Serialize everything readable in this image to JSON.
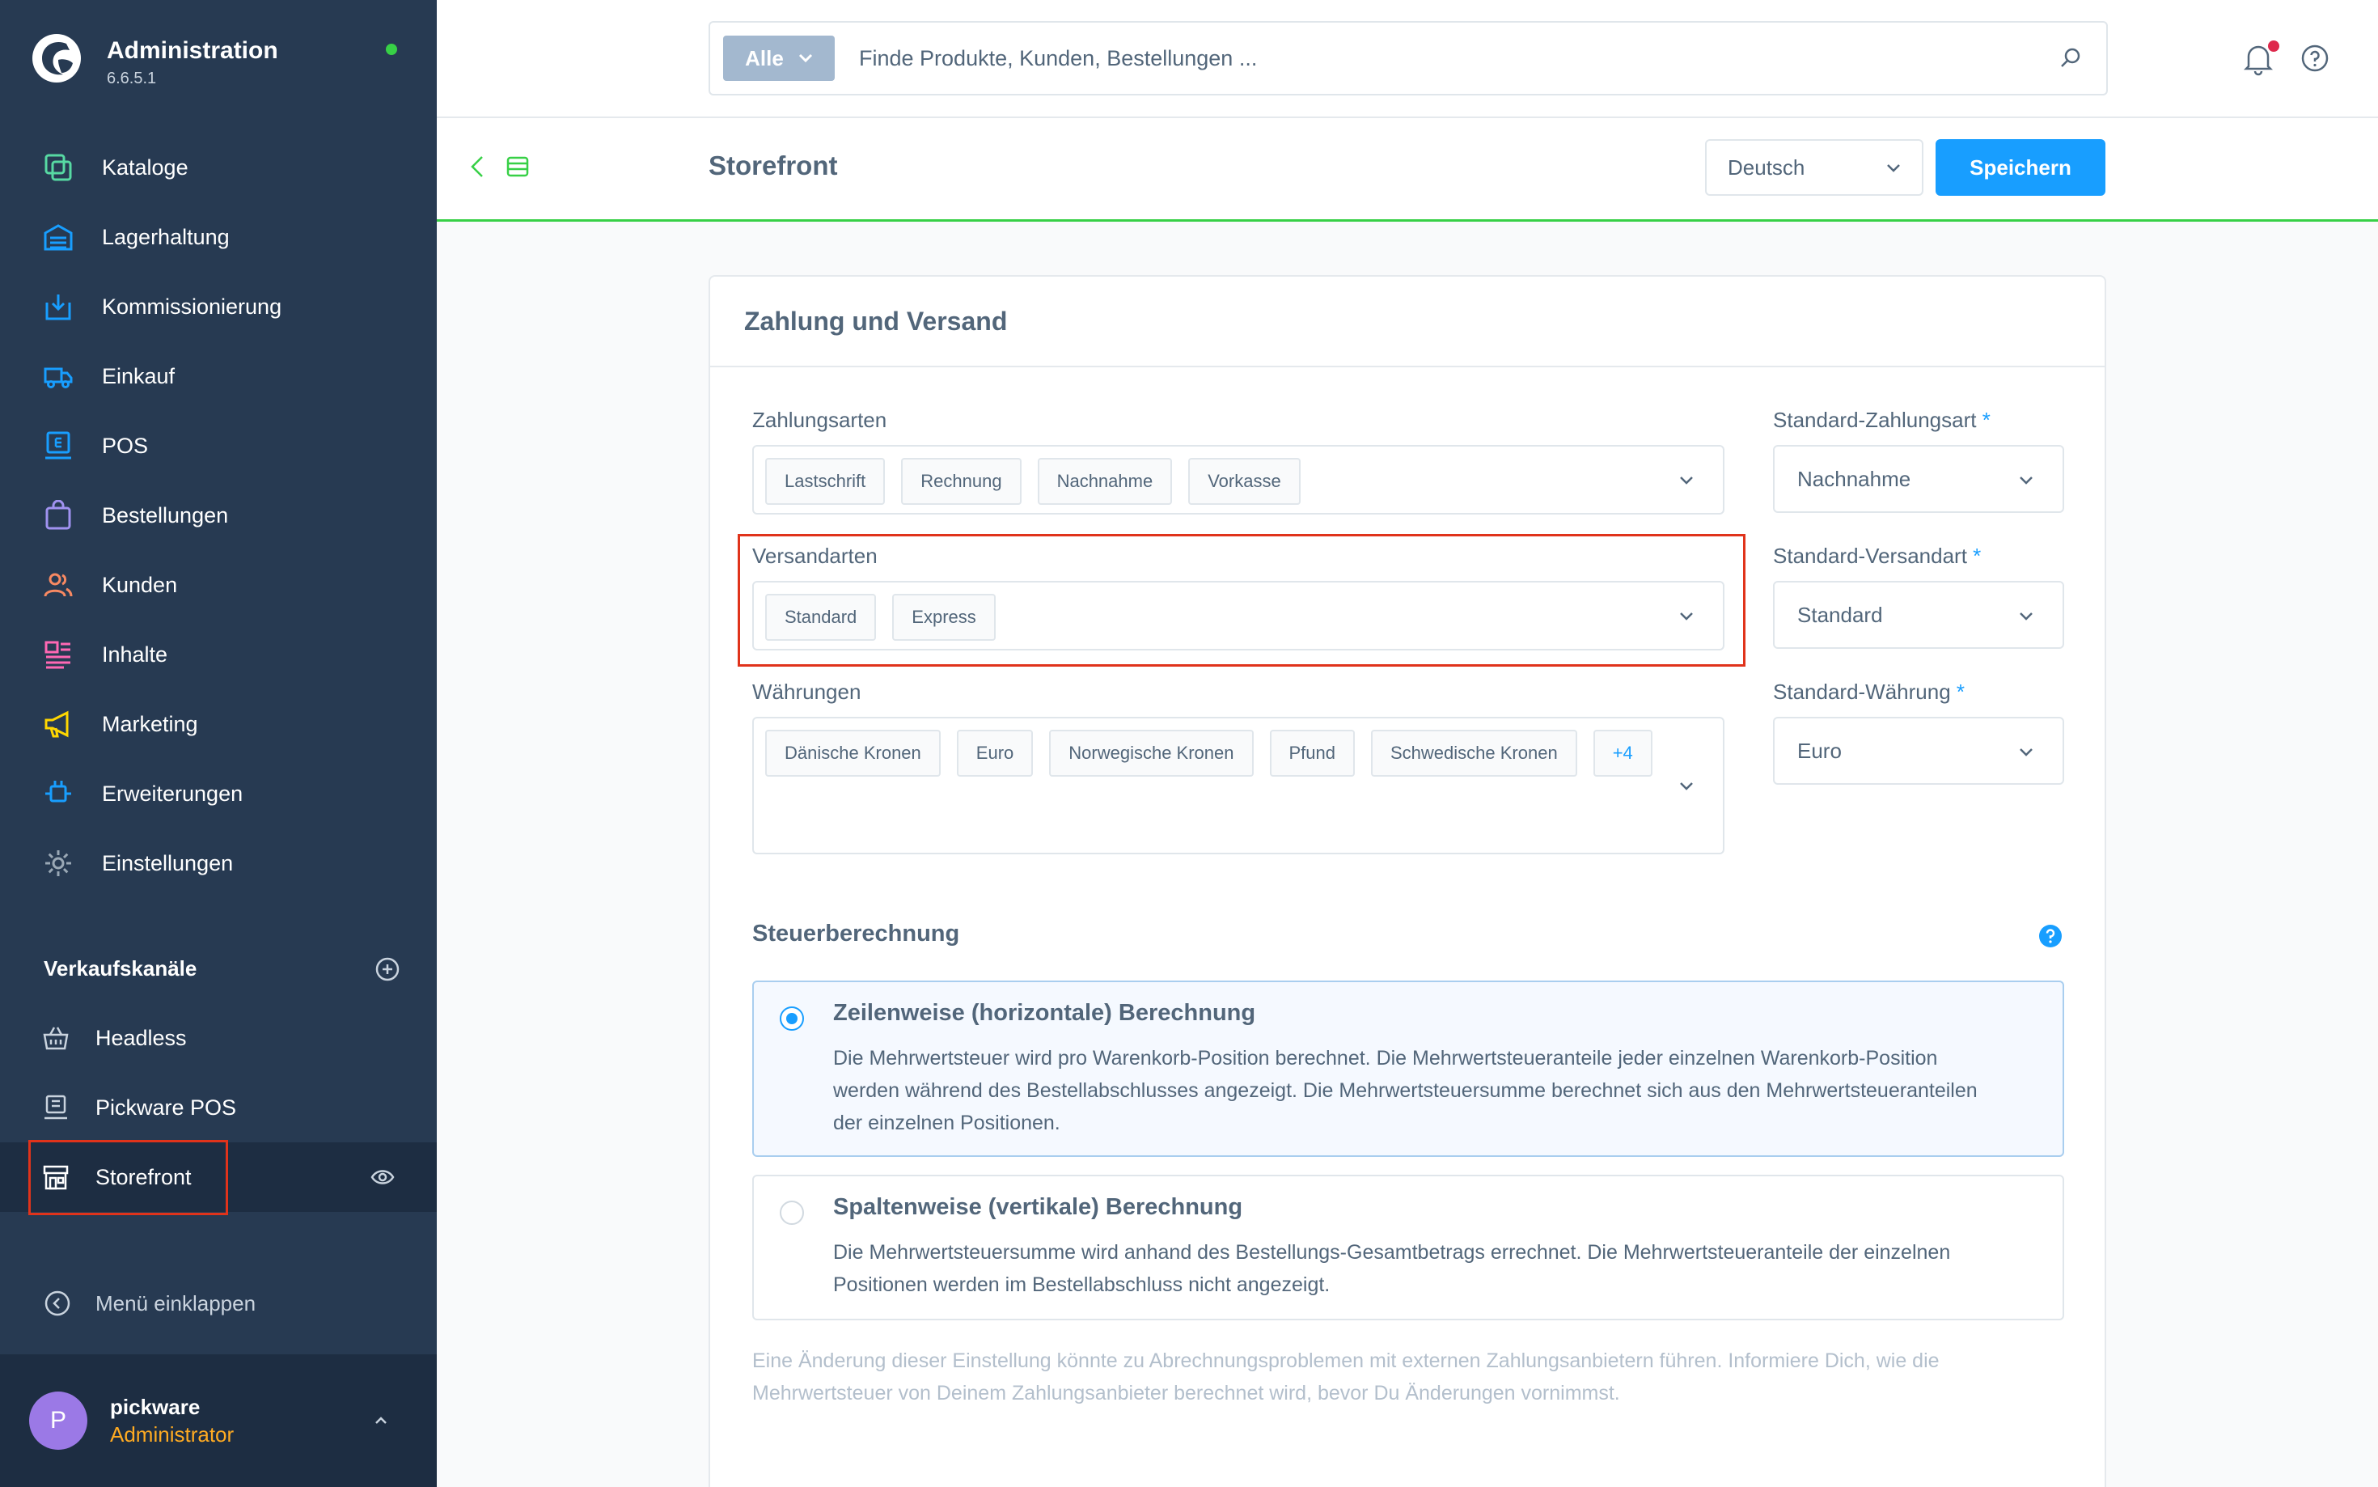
{
  "app": {
    "title": "Administration",
    "version": "6.6.5.1"
  },
  "nav": {
    "items": [
      {
        "label": "Kataloge",
        "icon": "catalog-icon",
        "color": "#57d9a3"
      },
      {
        "label": "Lagerhaltung",
        "icon": "warehouse-icon",
        "color": "#189eff"
      },
      {
        "label": "Kommissionierung",
        "icon": "picking-icon",
        "color": "#189eff"
      },
      {
        "label": "Einkauf",
        "icon": "truck-icon",
        "color": "#189eff"
      },
      {
        "label": "POS",
        "icon": "pos-icon",
        "color": "#189eff"
      },
      {
        "label": "Bestellungen",
        "icon": "shopping-bag-icon",
        "color": "#a092f0"
      },
      {
        "label": "Kunden",
        "icon": "users-icon",
        "color": "#f88962"
      },
      {
        "label": "Inhalte",
        "icon": "content-icon",
        "color": "#ff68b4"
      },
      {
        "label": "Marketing",
        "icon": "megaphone-icon",
        "color": "#ffd700"
      },
      {
        "label": "Erweiterungen",
        "icon": "plugin-icon",
        "color": "#189eff"
      },
      {
        "label": "Einstellungen",
        "icon": "gear-icon",
        "color": "#9aa8b5"
      }
    ]
  },
  "sales_channels": {
    "title": "Verkaufskanäle",
    "items": [
      {
        "label": "Headless",
        "icon": "basket-icon"
      },
      {
        "label": "Pickware POS",
        "icon": "pos-terminal-icon"
      },
      {
        "label": "Storefront",
        "icon": "storefront-icon"
      }
    ]
  },
  "collapse_label": "Menü einklappen",
  "user": {
    "initial": "P",
    "name": "pickware",
    "role": "Administrator"
  },
  "search": {
    "type_label": "Alle",
    "placeholder": "Finde Produkte, Kunden, Bestellungen ..."
  },
  "smartbar": {
    "title": "Storefront",
    "language": "Deutsch",
    "save_label": "Speichern"
  },
  "card": {
    "title": "Zahlung und Versand",
    "payment_methods": {
      "label": "Zahlungsarten",
      "tags": [
        "Lastschrift",
        "Rechnung",
        "Nachnahme",
        "Vorkasse"
      ]
    },
    "default_payment": {
      "label": "Standard-Zahlungsart",
      "required": "*",
      "value": "Nachnahme"
    },
    "shipping_methods": {
      "label": "Versandarten",
      "tags": [
        "Standard",
        "Express"
      ]
    },
    "default_shipping": {
      "label": "Standard-Versandart",
      "required": "*",
      "value": "Standard"
    },
    "currencies": {
      "label": "Währungen",
      "tags": [
        "Dänische Kronen",
        "Euro",
        "Norwegische Kronen",
        "Pfund",
        "Schwedische Kronen"
      ],
      "more": "+4"
    },
    "default_currency": {
      "label": "Standard-Währung",
      "required": "*",
      "value": "Euro"
    },
    "tax": {
      "title": "Steuerberechnung",
      "options": [
        {
          "title": "Zeilenweise (horizontale) Berechnung",
          "description": "Die Mehrwertsteuer wird pro Warenkorb-Position berechnet. Die Mehrwertsteueranteile jeder einzelnen Warenkorb-Position werden während des Bestellabschlusses angezeigt. Die Mehrwertsteuersumme berechnet sich aus den Mehrwertsteueranteilen der einzelnen Positionen.",
          "selected": true
        },
        {
          "title": "Spaltenweise (vertikale) Berechnung",
          "description": "Die Mehrwertsteuersumme wird anhand des Bestellungs-Gesamtbetrags errechnet. Die Mehrwertsteueranteile der einzelnen Positionen werden im Bestellabschluss nicht angezeigt.",
          "selected": false
        }
      ],
      "footnote": "Eine Änderung dieser Einstellung könnte zu Abrechnungsproblemen mit externen Zahlungsanbietern führen. Informiere Dich, wie die Mehrwertsteuer von Deinem Zahlungsanbieter berechnet wird, bevor Du Änderungen vornimmst."
    }
  },
  "colors": {
    "sidebar": "#273a52",
    "accent": "#189eff",
    "success": "#37d046",
    "highlight": "#e0331b",
    "user_role": "#ffab22"
  }
}
